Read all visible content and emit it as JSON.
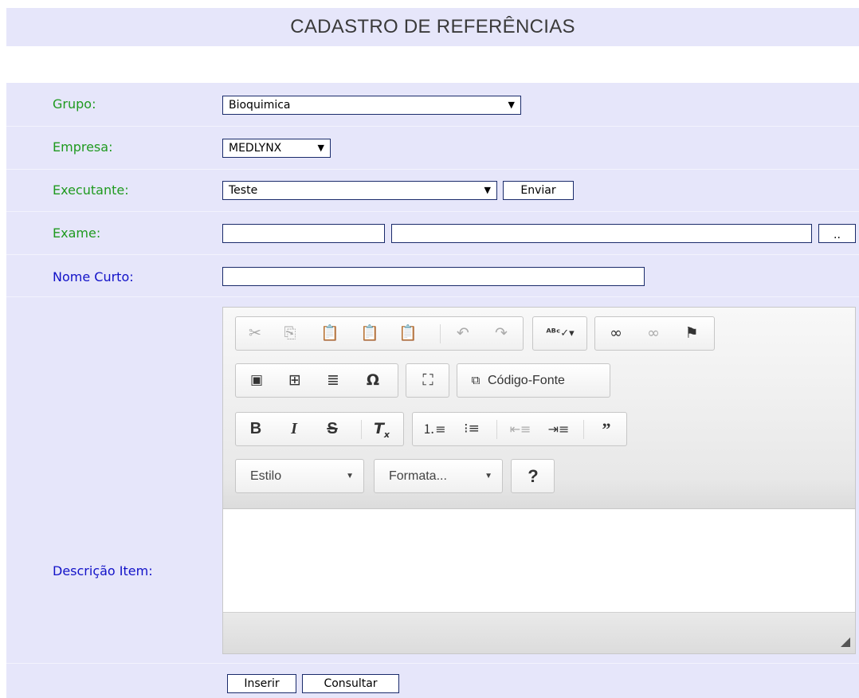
{
  "page": {
    "title": "CADASTRO DE REFERÊNCIAS"
  },
  "form": {
    "grupo": {
      "label": "Grupo:",
      "value": "Bioquimica"
    },
    "empresa": {
      "label": "Empresa:",
      "value": "MEDLYNX"
    },
    "executante": {
      "label": "Executante:",
      "value": "Teste",
      "submit_label": "Enviar"
    },
    "exame": {
      "label": "Exame:",
      "code_value": "",
      "name_value": "",
      "lookup_label": ".."
    },
    "nome_curto": {
      "label": "Nome Curto:",
      "value": ""
    },
    "descricao": {
      "label": "Descrição Item:"
    },
    "actions": {
      "insert_label": "Inserir",
      "query_label": "Consultar"
    }
  },
  "editor": {
    "source_label": "Código-Fonte",
    "style_combo": "Estilo",
    "format_combo": "Formata...",
    "help_label": "?",
    "bold_label": "B",
    "italic_label": "I",
    "strike_label": "S",
    "icons": {
      "row1": [
        "cut-icon",
        "copy-icon",
        "paste-icon",
        "paste-text-icon",
        "paste-word-icon",
        "undo-icon",
        "redo-icon",
        "spellcheck-icon",
        "link-icon",
        "unlink-icon",
        "anchor-icon"
      ],
      "row2": [
        "image-icon",
        "table-icon",
        "horizontal-line-icon",
        "special-char-icon",
        "maximize-icon",
        "source-icon"
      ],
      "row3": [
        "bold-icon",
        "italic-icon",
        "strike-icon",
        "remove-format-icon",
        "numbered-list-icon",
        "bulleted-list-icon",
        "outdent-icon",
        "indent-icon",
        "blockquote-icon"
      ]
    }
  },
  "colors": {
    "panel": "#e6e6fa",
    "label_green": "#1f9a1f",
    "label_blue": "#1212c8",
    "border": "#1a2b6b"
  }
}
